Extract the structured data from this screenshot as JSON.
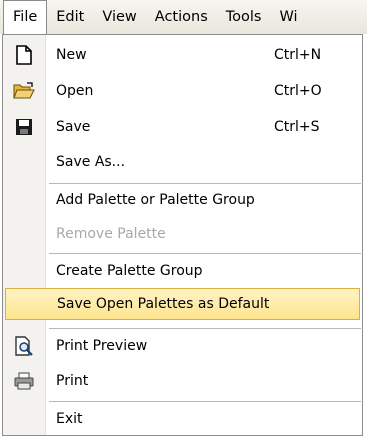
{
  "menubar": {
    "items": [
      {
        "label": "File"
      },
      {
        "label": "Edit"
      },
      {
        "label": "View"
      },
      {
        "label": "Actions"
      },
      {
        "label": "Tools"
      },
      {
        "label": "Wi"
      }
    ]
  },
  "file_menu": {
    "items": [
      {
        "label": "New",
        "shortcut": "Ctrl+N",
        "icon": "new-document-icon"
      },
      {
        "label": "Open",
        "shortcut": "Ctrl+O",
        "icon": "open-folder-icon"
      },
      {
        "label": "Save",
        "shortcut": "Ctrl+S",
        "icon": "floppy-disk-icon"
      },
      {
        "label": "Save As..."
      },
      {
        "label": "Add Palette or Palette Group"
      },
      {
        "label": "Remove Palette",
        "disabled": true
      },
      {
        "label": "Create Palette Group"
      },
      {
        "label": "Save Open Palettes as Default",
        "highlighted": true
      },
      {
        "label": "Print Preview",
        "icon": "print-preview-icon"
      },
      {
        "label": "Print",
        "icon": "printer-icon"
      },
      {
        "label": "Exit"
      }
    ]
  },
  "colors": {
    "highlight_fill": "#fde48e",
    "highlight_border": "#d9b13c",
    "disabled_text": "#a8a8a8"
  }
}
